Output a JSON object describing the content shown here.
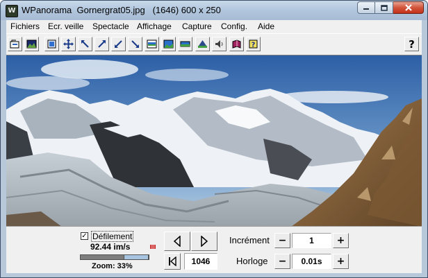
{
  "window": {
    "app_icon": "W",
    "title": "WPanorama  Gornergrat05.jpg   (1646) 600 x 250"
  },
  "menu": {
    "items": [
      "Fichiers",
      "Ecr. veille",
      "Spectacle",
      "Affichage",
      "Capture",
      "Config.",
      "Aide"
    ]
  },
  "toolbar": {
    "buttons": [
      {
        "icon": "open-file-icon"
      },
      {
        "icon": "picture-icon"
      },
      {
        "icon": "fit-window-icon"
      },
      {
        "icon": "move-arrows-icon"
      },
      {
        "icon": "shrink-top-left-icon"
      },
      {
        "icon": "expand-top-right-icon"
      },
      {
        "icon": "shrink-bottom-left-icon"
      },
      {
        "icon": "expand-bottom-right-icon"
      },
      {
        "icon": "panorama-small-icon"
      },
      {
        "icon": "panorama-medium-icon"
      },
      {
        "icon": "panorama-wide-icon"
      },
      {
        "icon": "landscape-icon"
      },
      {
        "icon": "speaker-icon"
      },
      {
        "icon": "book-icon"
      },
      {
        "icon": "help-book-icon"
      }
    ],
    "help_label": "?"
  },
  "controls": {
    "scroll_label": "Défilement",
    "scroll_checked": true,
    "check_mark": "✓",
    "speed": "92.44 im/s",
    "zoom": "Zoom: 33%",
    "zoom_fraction": 0.33,
    "image_index": "1046",
    "increment_label": "Incrément",
    "increment_value": "1",
    "clock_label": "Horloge",
    "clock_value": "0.01s",
    "minus": "−",
    "plus": "+"
  },
  "colors": {
    "title_bar": "#b7c8db",
    "close_button": "#c3321a",
    "zoom_thumb": "#a7c4e0"
  }
}
